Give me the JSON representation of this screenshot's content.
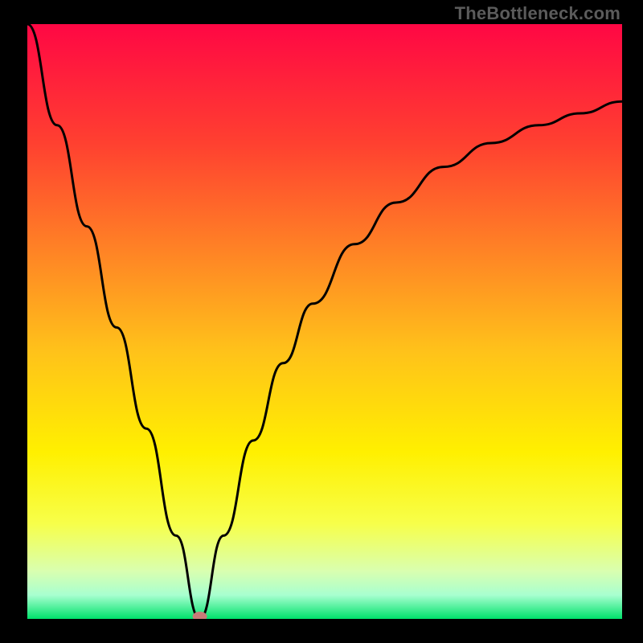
{
  "watermark": "TheBottleneck.com",
  "chart_data": {
    "type": "line",
    "title": "",
    "xlabel": "",
    "ylabel": "",
    "xlim": [
      0,
      100
    ],
    "ylim": [
      0,
      100
    ],
    "min_marker": {
      "x": 29,
      "y": 0
    },
    "series": [
      {
        "name": "curve",
        "x": [
          0,
          5,
          10,
          15,
          20,
          25,
          29,
          33,
          38,
          43,
          48,
          55,
          62,
          70,
          78,
          86,
          93,
          100
        ],
        "y": [
          100,
          83,
          66,
          49,
          32,
          14,
          0,
          14,
          30,
          43,
          53,
          63,
          70,
          76,
          80,
          83,
          85,
          87
        ]
      }
    ],
    "gradient_stops": [
      {
        "offset": 0.0,
        "color": "#ff0744"
      },
      {
        "offset": 0.2,
        "color": "#ff4030"
      },
      {
        "offset": 0.4,
        "color": "#ff8a24"
      },
      {
        "offset": 0.55,
        "color": "#ffc21a"
      },
      {
        "offset": 0.72,
        "color": "#fff000"
      },
      {
        "offset": 0.84,
        "color": "#f7ff4a"
      },
      {
        "offset": 0.92,
        "color": "#d9ffb0"
      },
      {
        "offset": 0.96,
        "color": "#a8ffd0"
      },
      {
        "offset": 1.0,
        "color": "#00e26b"
      }
    ]
  }
}
